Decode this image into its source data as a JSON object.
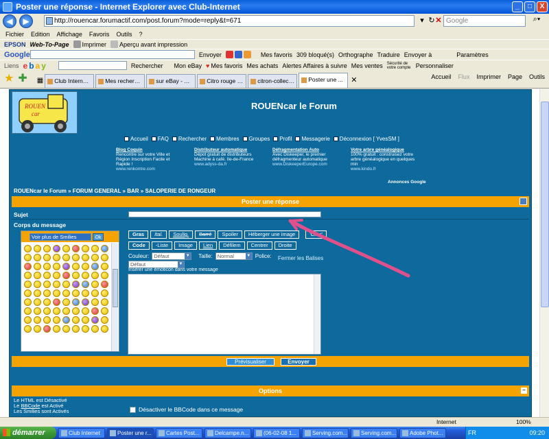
{
  "window": {
    "title": "Poster une réponse - Internet Explorer avec Club-Internet",
    "buttons": {
      "min": "_",
      "max": "□",
      "close": "X"
    }
  },
  "address": {
    "url": "http://rouencar.forumactif.com/post.forum?mode=reply&t=671",
    "search_placeholder": "Google"
  },
  "menu": [
    "Fichier",
    "Edition",
    "Affichage",
    "Favoris",
    "Outils",
    "?"
  ],
  "toolbar_epson": {
    "brand": "EPSON",
    "webtopage": "Web-To-Page",
    "print": "Imprimer",
    "preview": "Aperçu avant impression"
  },
  "toolbar_google": {
    "brand": "Google",
    "send": "Envoyer",
    "favs": "Mes favoris",
    "blocked": "309 bloqué(s)",
    "spell": "Orthographe",
    "translate": "Traduire",
    "sendto": "Envoyer à",
    "settings": "Paramètres"
  },
  "toolbar_ebay": {
    "links": "Liens",
    "search": "Rechercher",
    "mon_ebay": "Mon eBay",
    "mes_favoris": "Mes favoris",
    "achats": "Mes achats",
    "alertes": "Alertes Affaires à suivre",
    "ventes": "Mes ventes",
    "securite": "Sécurité de votre compte",
    "perso": "Personnaliser"
  },
  "tabs": [
    {
      "label": "Club Internet, ..."
    },
    {
      "label": "Mes recherches..."
    },
    {
      "label": "sur eBay - Ach..."
    },
    {
      "label": "Citro rouge et ..."
    },
    {
      "label": "citron-collectio..."
    },
    {
      "label": "Poster une ..."
    }
  ],
  "commandbar": {
    "home": "Accueil",
    "rss": "Flux",
    "print": "Imprimer",
    "page": "Page",
    "tools": "Outils"
  },
  "forum": {
    "title": "ROUENcar le Forum",
    "logo_text": "ROUEN car",
    "nav": [
      "Accueil",
      "FAQ",
      "Rechercher",
      "Membres",
      "Groupes",
      "Profil",
      "Messagerie",
      "Déconnexion [ YvesSM ]"
    ],
    "ads": [
      {
        "title": "Blog Coquin",
        "text": "Rencontre sur votre Ville et Région Inscription Facile et Rapide !",
        "url": "www.renkontre.com"
      },
      {
        "title": "Distributeur automatique",
        "text": "Dépot gratuit de distributeurs Machine à café. Ile-de-France",
        "url": "www.adyss-da.fr"
      },
      {
        "title": "Défragmentation Auto",
        "text": "Avec Diskeeper, le premier défragmenteur automatique",
        "url": "www.DiskeeperEurope.com"
      },
      {
        "title": "Votre arbre généalogique",
        "text": "100% gratuit : construisez votre arbre généalogique en quelques min",
        "url": "www.kindo.fr"
      }
    ],
    "ads_by": "Annonces Google",
    "breadcrumb": "ROUENcar le Forum » FORUM GENERAL » BAR » SALOPERIE DE RONGEUR",
    "post_header": "Poster une réponse",
    "subject_label": "Sujet",
    "body_label": "Corps du message",
    "smilies_select": "Voir plus de Smilies",
    "ok": "Ok",
    "bbcode_row1": [
      "Gras",
      "Ital.",
      "Soulig.",
      "Barré",
      "Spoiler",
      "Héberger une image",
      "'Citer'"
    ],
    "bbcode_row2": [
      "Code",
      "-Liste",
      "Image",
      "Lien",
      "Défilem",
      "Centrer",
      "Droite"
    ],
    "couleur_label": "Couleur:",
    "couleur_value": "Défaut",
    "taille_label": "Taille:",
    "taille_value": "Normal",
    "police_label": "Police:",
    "police_value": "Défaut",
    "fermer": "Fermer les Balises",
    "insert_emoticon": "Insérer une émoticon dans votre message",
    "preview_btn": "Prévisualiser",
    "send_btn": "Envoyer",
    "options_header": "Options",
    "opt_html": "Le HTML est Désactivé",
    "opt_bbcode_pre": "Le ",
    "opt_bbcode_link": "BBCode",
    "opt_bbcode_post": " est Activé",
    "opt_smilies": "Les Smilies sont Activés",
    "opt_disable_bbcode": "Désactiver le BBCode dans ce message"
  },
  "status": {
    "zone": "Internet",
    "zoom": "100%"
  },
  "taskbar": {
    "start": "démarrer",
    "tasks": [
      "Club Internet",
      "Poster une r...",
      "Cartes Post...",
      "Delcampe.n...",
      "(06-02-08 1...",
      "Serving.com...",
      "Serving.com...",
      "Adobe Phot..."
    ],
    "lang": "FR",
    "clock": "09:20"
  },
  "colors": {
    "forum_bg": "#0e6a9c",
    "accent_orange": "#f4a300",
    "annotation": "#e0508a"
  }
}
